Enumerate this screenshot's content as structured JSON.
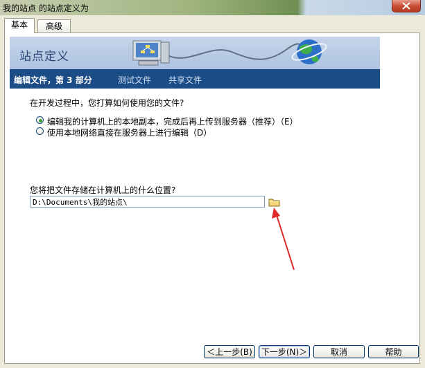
{
  "window": {
    "title": "我的站点 的站点定义为"
  },
  "tabs": [
    {
      "label": "基本"
    },
    {
      "label": "高级"
    }
  ],
  "banner": {
    "title": "站点定义"
  },
  "steps": {
    "current": "编辑文件，第 3 部分",
    "test": "测试文件",
    "share": "共享文件"
  },
  "question1": "在开发过程中，您打算如何使用您的文件?",
  "options": [
    {
      "label": "编辑我的计算机上的本地副本，完成后再上传到服务器（推荐）（E）",
      "selected": true
    },
    {
      "label": "使用本地网络直接在服务器上进行编辑（D）",
      "selected": false
    }
  ],
  "question2": "您将把文件存储在计算机上的什么位置?",
  "path_value": "D:\\Documents\\我的站点\\",
  "buttons": {
    "back": "＜上一步(B)",
    "next": "下一步(N)＞",
    "cancel": "取消",
    "help": "帮助"
  },
  "colors": {
    "stepbar": "#1b4c86",
    "banner": "#b9cbe6",
    "annotation_arrow": "#e02a2a"
  },
  "icons": {
    "close": "close-icon",
    "folder": "folder-icon",
    "computer": "computer-icon",
    "globe": "globe-icon"
  }
}
